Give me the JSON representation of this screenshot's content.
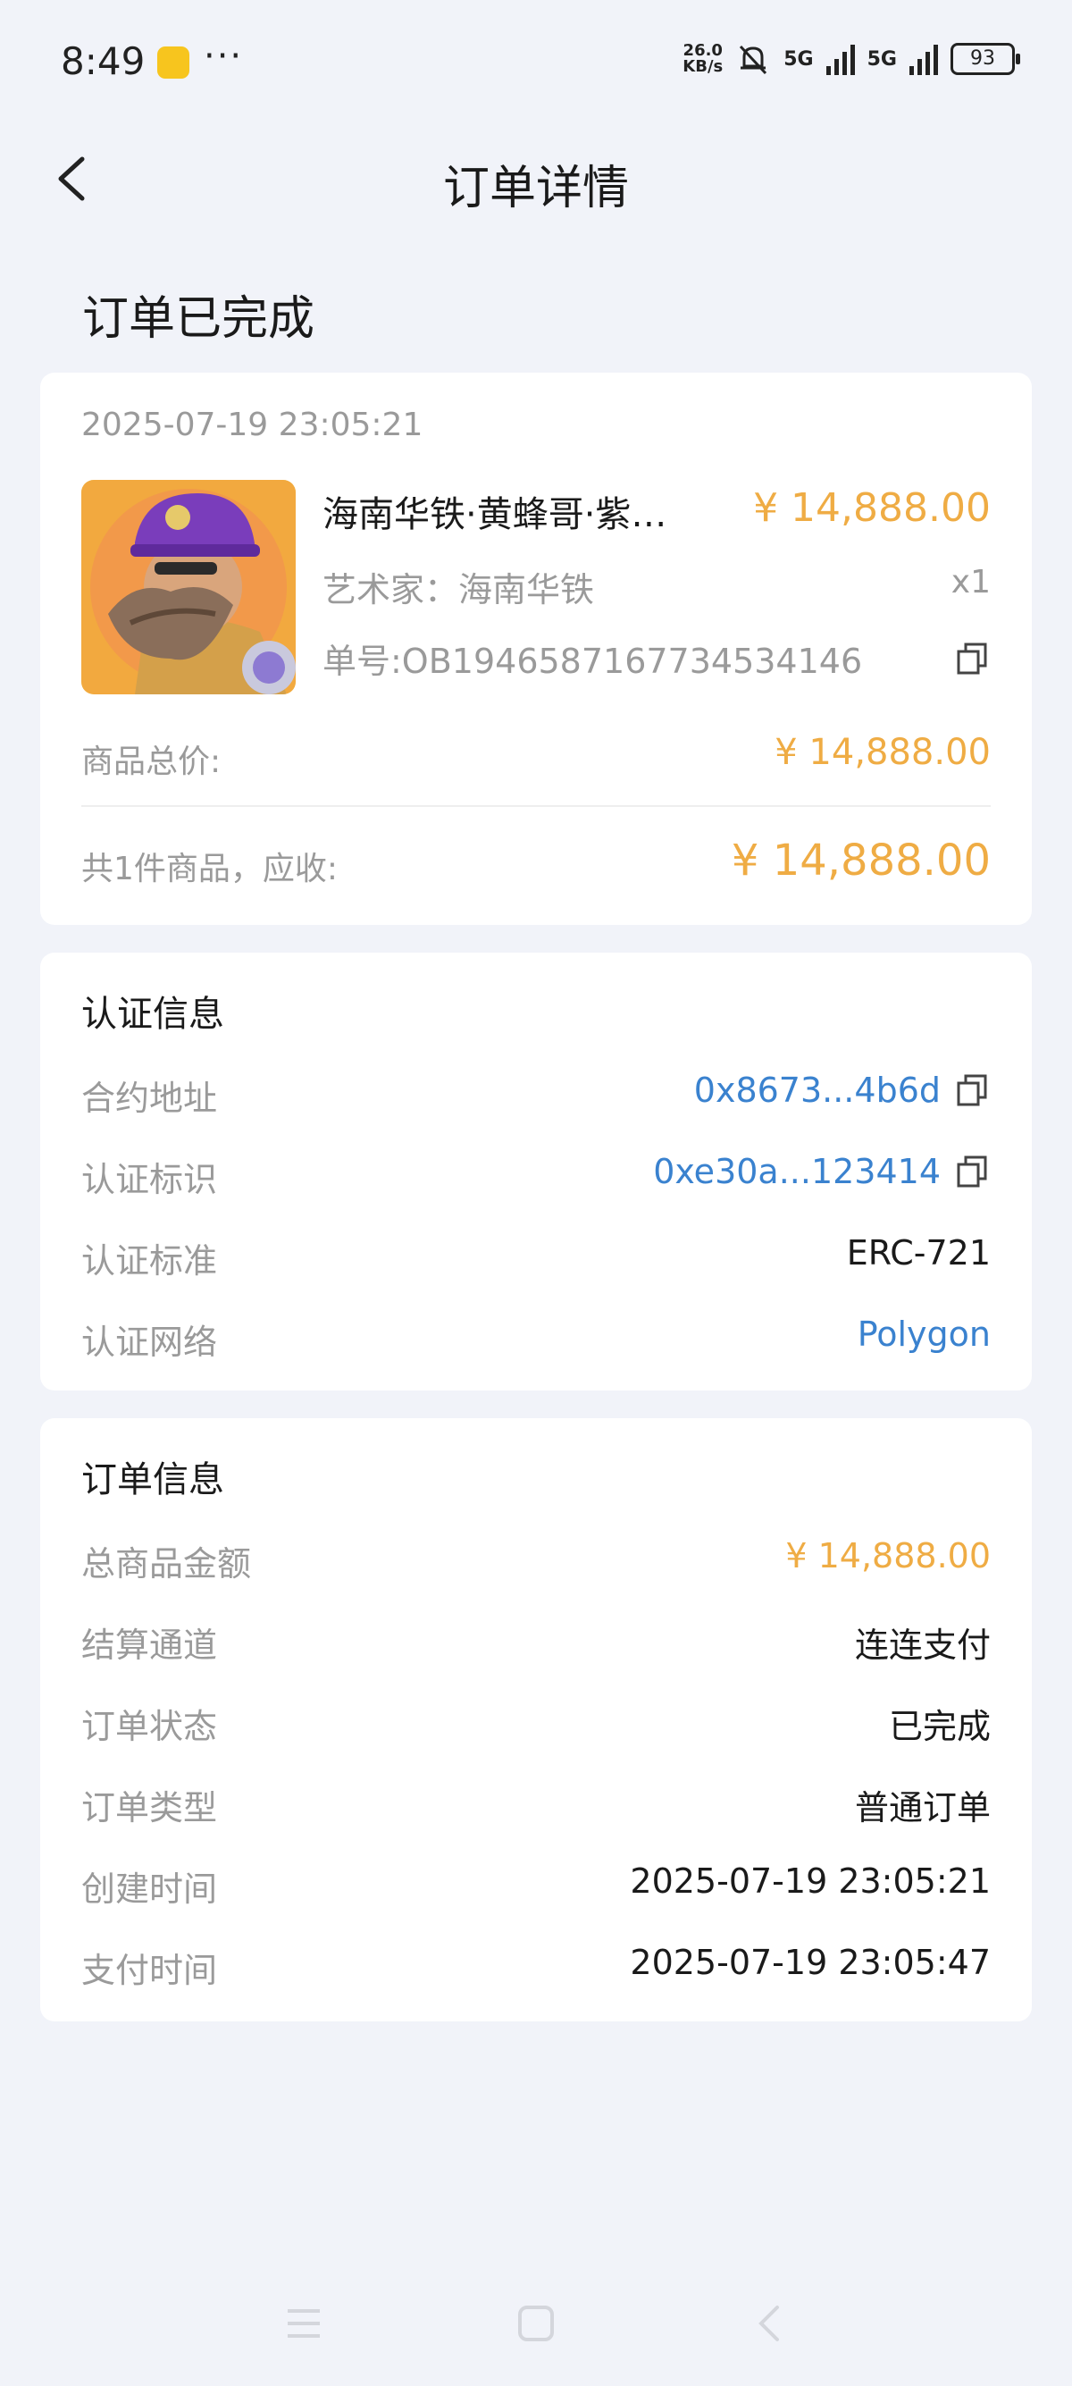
{
  "status_bar": {
    "time": "8:49",
    "dots": "···",
    "speed_top": "26.0",
    "speed_bottom": "KB/s",
    "net1": "5G",
    "net2": "5G",
    "battery": "93"
  },
  "header": {
    "title": "订单详情"
  },
  "order_status": "订单已完成",
  "product_card": {
    "timestamp": "2025-07-19 23:05:21",
    "name": "海南华铁·黄蜂哥·紫…",
    "price": "¥ 14,888.00",
    "artist": "艺术家：海南华铁",
    "quantity": "x1",
    "order_no": "单号:OB1946587167734534146",
    "subtotal_label": "商品总价:",
    "subtotal_value": "¥ 14,888.00",
    "total_label": "共1件商品，应收:",
    "total_value": "¥ 14,888.00"
  },
  "auth_info": {
    "title": "认证信息",
    "rows": [
      {
        "label": "合约地址",
        "value": "0x8673...4b6d"
      },
      {
        "label": "认证标识",
        "value": "0xe30a...123414"
      },
      {
        "label": "认证标准",
        "value": "ERC-721"
      },
      {
        "label": "认证网络",
        "value": "Polygon"
      }
    ]
  },
  "order_info": {
    "title": "订单信息",
    "rows": [
      {
        "label": "总商品金额",
        "value": "¥ 14,888.00"
      },
      {
        "label": "结算通道",
        "value": "连连支付"
      },
      {
        "label": "订单状态",
        "value": "已完成"
      },
      {
        "label": "订单类型",
        "value": "普通订单"
      },
      {
        "label": "创建时间",
        "value": "2025-07-19 23:05:21"
      },
      {
        "label": "支付时间",
        "value": "2025-07-19 23:05:47"
      }
    ]
  },
  "colors": {
    "accent_orange": "#efac44",
    "link_blue": "#3a82cf",
    "background": "#f1f3f9"
  }
}
